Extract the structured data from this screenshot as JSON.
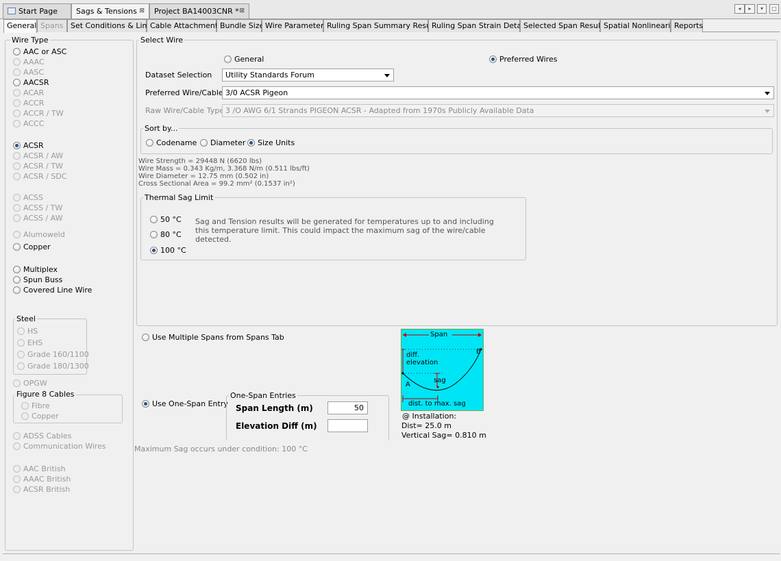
{
  "doc_tabs": [
    {
      "label": "Start Page"
    },
    {
      "label": "Sags & Tensions"
    },
    {
      "label": "Project BA14003CNR *"
    }
  ],
  "window_buttons": [
    "◂",
    "▸",
    "▾",
    "□"
  ],
  "sub_tabs": [
    {
      "label": "General"
    },
    {
      "label": "Spans"
    },
    {
      "label": "Set Conditions & Limits"
    },
    {
      "label": "Cable Attachments"
    },
    {
      "label": "Bundle Size"
    },
    {
      "label": "Wire Parameters"
    },
    {
      "label": "Ruling Span Summary Results"
    },
    {
      "label": "Ruling Span Strain Details"
    },
    {
      "label": "Selected Span Results"
    },
    {
      "label": "Spatial Nonlinearity"
    },
    {
      "label": "Reports"
    }
  ],
  "wire_type": {
    "legend": "Wire Type",
    "items": [
      {
        "label": "AAC or ASC"
      },
      {
        "label": "AAAC"
      },
      {
        "label": "AASC"
      },
      {
        "label": "AACSR"
      },
      {
        "label": "ACAR"
      },
      {
        "label": "ACCR"
      },
      {
        "label": "ACCR / TW"
      },
      {
        "label": "ACCC"
      },
      {
        "label": "ACSR"
      },
      {
        "label": "ACSR / AW"
      },
      {
        "label": "ACSR / TW"
      },
      {
        "label": "ACSR / SDC"
      },
      {
        "label": "ACSS"
      },
      {
        "label": "ACSS / TW"
      },
      {
        "label": "ACSS / AW"
      },
      {
        "label": "Alumoweld"
      },
      {
        "label": "Copper"
      },
      {
        "label": "Multiplex"
      },
      {
        "label": "Spun Buss"
      },
      {
        "label": "Covered Line Wire"
      }
    ],
    "steel": {
      "legend": "Steel",
      "items": [
        {
          "label": "HS"
        },
        {
          "label": "EHS"
        },
        {
          "label": "Grade 160/1100"
        },
        {
          "label": "Grade 180/1300"
        }
      ]
    },
    "opgw": "OPGW",
    "figure8": {
      "legend": "Figure 8 Cables",
      "items": [
        {
          "label": "Fibre"
        },
        {
          "label": "Copper"
        }
      ]
    },
    "more": [
      {
        "label": "ADSS Cables"
      },
      {
        "label": "Communication Wires"
      },
      {
        "label": "AAC British"
      },
      {
        "label": "AAAC British"
      },
      {
        "label": "ACSR British"
      }
    ]
  },
  "select_wire": {
    "legend": "Select Wire",
    "general_label": "General",
    "preferred_label": "Preferred Wires",
    "dataset_label": "Dataset Selection",
    "dataset_value": "Utility Standards Forum",
    "preferred_wire_label": "Preferred Wire/Cable:",
    "preferred_wire_value": "3/0 ACSR Pigeon",
    "raw_wire_label": "Raw Wire/Cable Type:",
    "raw_wire_value": "3 /O AWG 6/1 Strands PIGEON ACSR - Adapted from 1970s Publicly Available Data",
    "sort_legend": "Sort by...",
    "sort_options": [
      "Codename",
      "Diameter",
      "Size Units"
    ],
    "wire_info": [
      "Wire Strength = 29448 N (6620 lbs)",
      "Wire Mass = 0.343 Kg/m, 3.368 N/m (0.511 lbs/ft)",
      "Wire Diameter = 12.75 mm (0.502 in)",
      "Cross Sectional Area = 99.2 mm² (0.1537 in²)"
    ],
    "thermal": {
      "legend": "Thermal Sag Limit",
      "options": [
        "50 °C",
        "80 °C",
        "100 °C"
      ],
      "note_lines": [
        "Sag and Tension results will be generated for temperatures up to and including",
        "this temperature limit. This could impact the maximum sag of the wire/cable",
        "detected."
      ]
    }
  },
  "spans": {
    "multi_label": "Use Multiple Spans from Spans Tab",
    "one_label": "Use One-Span Entry",
    "entries_legend": "One-Span Entries",
    "span_length_label": "Span Length (m)",
    "span_length_value": "50",
    "elev_diff_label": "Elevation Diff (m)",
    "elev_diff_value": "",
    "max_sag_note": "Maximum Sag occurs under condition: 100 °C"
  },
  "diagram": {
    "span_label": "Span",
    "diff_label": "diff.",
    "elevation_label": "elevation",
    "sag_label": "sag",
    "a_label": "A",
    "b_label": "B",
    "dist_label": "dist. to max. sag",
    "bg_color": "#00e5f5",
    "installation_title": "@ Installation:",
    "installation_dist": "Dist= 25.0 m",
    "installation_sag": "Vertical Sag= 0.810 m"
  }
}
